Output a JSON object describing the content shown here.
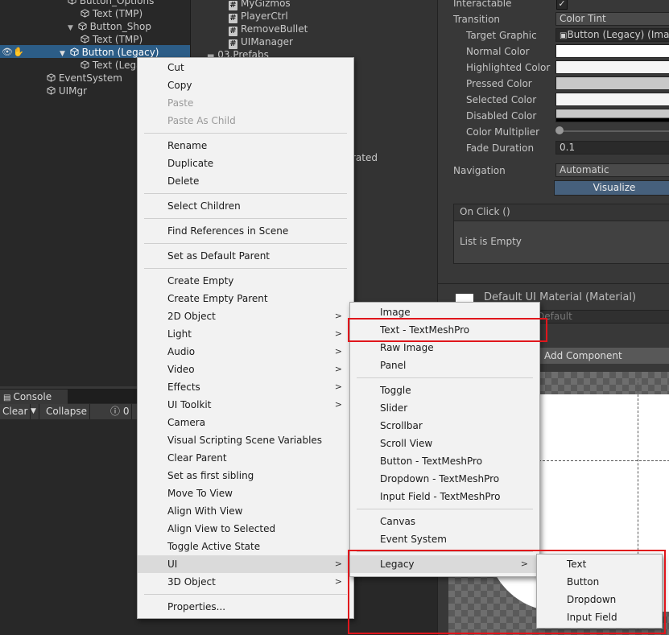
{
  "hierarchy": {
    "items": [
      {
        "label": "Button_Options",
        "indent": 1
      },
      {
        "label": "Text (TMP)",
        "indent": 2
      },
      {
        "label": "Button_Shop",
        "indent": 1
      },
      {
        "label": "Text (TMP)",
        "indent": 2
      },
      {
        "label": "Button (Legacy)",
        "indent": 1,
        "selected": true
      },
      {
        "label": "Text (Legacy)",
        "indent": 2
      },
      {
        "label": "EventSystem",
        "indent": 0
      },
      {
        "label": "UIMgr",
        "indent": 0
      }
    ]
  },
  "project": {
    "scripts": [
      "MyGizmos",
      "PlayerCtrl",
      "RemoveBullet",
      "UIManager"
    ],
    "folder": "03.Prefabs",
    "partial_text": "rated"
  },
  "inspector": {
    "interactable_label": "Interactable",
    "transition_label": "Transition",
    "transition_value": "Color Tint",
    "target_graphic_label": "Target Graphic",
    "target_graphic_value": "Button (Legacy) (Image)",
    "normal_color_label": "Normal Color",
    "highlighted_color_label": "Highlighted Color",
    "pressed_color_label": "Pressed Color",
    "selected_color_label": "Selected Color",
    "disabled_color_label": "Disabled Color",
    "color_multiplier_label": "Color Multiplier",
    "fade_duration_label": "Fade Duration",
    "fade_duration_value": "0.1",
    "navigation_label": "Navigation",
    "navigation_value": "Automatic",
    "visualize_label": "Visualize",
    "onclick_label": "On Click ()",
    "list_empty": "List is Empty",
    "material_label": "Default UI Material (Material)",
    "shader_partial": "Default",
    "add_component": "Add Component"
  },
  "console": {
    "tab": "Console",
    "clear": "Clear",
    "collapse": "Collapse",
    "count": "0"
  },
  "context_menu": {
    "items": [
      {
        "label": "Cut",
        "enabled": true
      },
      {
        "label": "Copy",
        "enabled": true
      },
      {
        "label": "Paste",
        "enabled": false
      },
      {
        "label": "Paste As Child",
        "enabled": false
      },
      {
        "label": "Rename",
        "enabled": true
      },
      {
        "label": "Duplicate",
        "enabled": true
      },
      {
        "label": "Delete",
        "enabled": true
      },
      {
        "label": "Select Children",
        "enabled": true
      },
      {
        "label": "Find References in Scene",
        "enabled": true
      },
      {
        "label": "Set as Default Parent",
        "enabled": true
      },
      {
        "label": "Create Empty",
        "enabled": true
      },
      {
        "label": "Create Empty Parent",
        "enabled": true
      },
      {
        "label": "2D Object",
        "enabled": true,
        "submenu": true
      },
      {
        "label": "Light",
        "enabled": true,
        "submenu": true
      },
      {
        "label": "Audio",
        "enabled": true,
        "submenu": true
      },
      {
        "label": "Video",
        "enabled": true,
        "submenu": true
      },
      {
        "label": "Effects",
        "enabled": true,
        "submenu": true
      },
      {
        "label": "UI Toolkit",
        "enabled": true,
        "submenu": true
      },
      {
        "label": "Camera",
        "enabled": true
      },
      {
        "label": "Visual Scripting Scene Variables",
        "enabled": true
      },
      {
        "label": "Clear Parent",
        "enabled": true
      },
      {
        "label": "Set as first sibling",
        "enabled": true
      },
      {
        "label": "Move To View",
        "enabled": true
      },
      {
        "label": "Align With View",
        "enabled": true
      },
      {
        "label": "Align View to Selected",
        "enabled": true
      },
      {
        "label": "Toggle Active State",
        "enabled": true
      },
      {
        "label": "UI",
        "enabled": true,
        "submenu": true,
        "highlighted": true
      },
      {
        "label": "3D Object",
        "enabled": true,
        "submenu": true
      },
      {
        "label": "Properties...",
        "enabled": true
      }
    ]
  },
  "ui_submenu": {
    "items": [
      {
        "label": "Image"
      },
      {
        "label": "Text - TextMeshPro",
        "outlined": true
      },
      {
        "label": "Raw Image"
      },
      {
        "label": "Panel"
      },
      {
        "label": "Toggle"
      },
      {
        "label": "Slider"
      },
      {
        "label": "Scrollbar"
      },
      {
        "label": "Scroll View"
      },
      {
        "label": "Button - TextMeshPro"
      },
      {
        "label": "Dropdown - TextMeshPro"
      },
      {
        "label": "Input Field - TextMeshPro"
      },
      {
        "label": "Canvas"
      },
      {
        "label": "Event System"
      },
      {
        "label": "Legacy",
        "submenu": true,
        "highlighted": true
      }
    ]
  },
  "legacy_submenu": {
    "items": [
      {
        "label": "Text"
      },
      {
        "label": "Button"
      },
      {
        "label": "Dropdown"
      },
      {
        "label": "Input Field"
      }
    ]
  },
  "icons": {
    "gameobject": "cube-icon",
    "script": "csharp-script-icon",
    "folder": "folder-icon",
    "submenu": "chevron-right-icon",
    "visibility": "eye-icon",
    "pick": "hand-icon",
    "check": "checkmark-icon",
    "warning": "info-icon"
  },
  "colors": {
    "highlight_outline": "#e0161c",
    "selection": "#2c5d87",
    "menu_bg": "#f2f2f2"
  }
}
